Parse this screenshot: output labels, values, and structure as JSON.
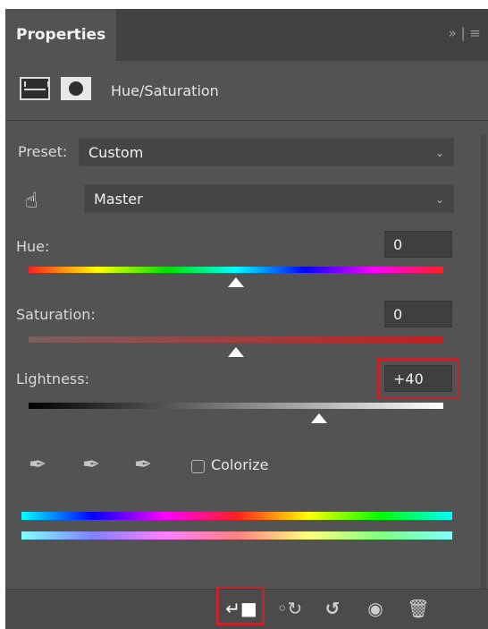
{
  "tabs": {
    "active_label": "Properties",
    "menu_label": "» | ≡"
  },
  "header": {
    "title": "Hue/Saturation",
    "icons": [
      "adjustment-layer-icon",
      "mask-icon"
    ]
  },
  "preset": {
    "label": "Preset:",
    "value": "Custom"
  },
  "channel": {
    "value": "Master",
    "icon": "targeted-adjustment-hand-icon"
  },
  "hue": {
    "label": "Hue:",
    "value": "0",
    "slider_fraction": 0.5
  },
  "saturation": {
    "label": "Saturation:",
    "value": "0",
    "slider_fraction": 0.5
  },
  "lightness": {
    "label": "Lightness:",
    "value": "+40",
    "slider_fraction": 0.7
  },
  "tools": {
    "eyedroppers": [
      "eyedropper-icon",
      "eyedropper-add-icon",
      "eyedropper-subtract-icon"
    ],
    "colorize_label": "Colorize",
    "colorize_checked": false
  },
  "footer": {
    "icons": [
      "clip-to-layer-icon",
      "view-previous-state-icon",
      "reset-icon",
      "visibility-eye-icon",
      "trash-icon"
    ]
  },
  "colors": {
    "panel": "#535353",
    "highlight": "#c0272d"
  }
}
